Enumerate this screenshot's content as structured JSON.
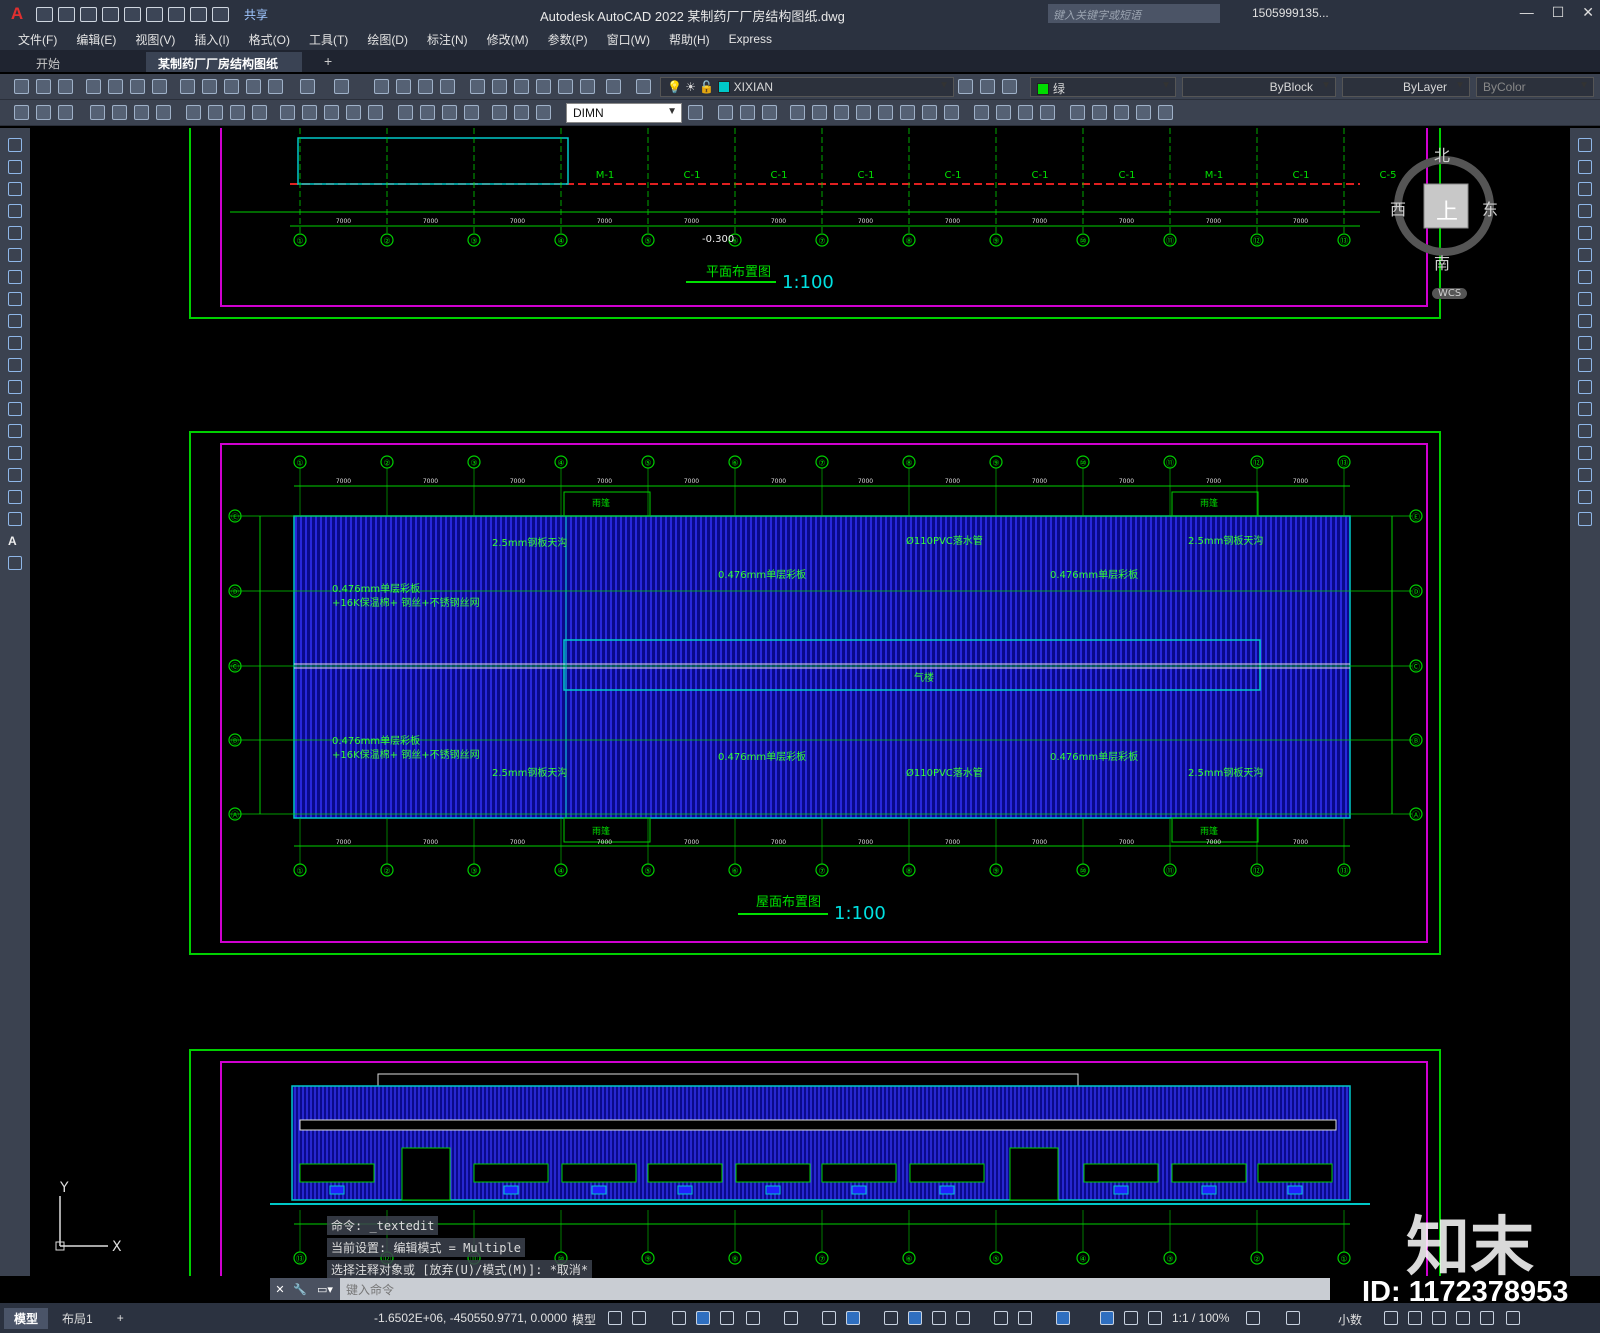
{
  "app": {
    "title": "Autodesk AutoCAD 2022    某制药厂厂房结构图纸.dwg",
    "logo": "A",
    "share": "共享",
    "search_placeholder": "键入关键字或短语",
    "user": "1505999135...",
    "min": "—",
    "max": "☐",
    "close": "✕"
  },
  "menu": [
    "文件(F)",
    "编辑(E)",
    "视图(V)",
    "插入(I)",
    "格式(O)",
    "工具(T)",
    "绘图(D)",
    "标注(N)",
    "修改(M)",
    "参数(P)",
    "窗口(W)",
    "帮助(H)",
    "Express"
  ],
  "tabs": {
    "start": "开始",
    "file": "某制药厂厂房结构图纸*",
    "close": "✕",
    "add": "+"
  },
  "toolbar": {
    "layer": "XIXIAN",
    "color": "绿",
    "linetype": "ByBlock",
    "lineweight": "ByLayer",
    "plotstyle": "ByColor",
    "dimstyle": "DIMN",
    "layer_color": "#00c8c8",
    "color_swatch": "#00dd00"
  },
  "viewcube": {
    "north": "北",
    "south": "南",
    "east": "东",
    "west": "西",
    "face": "上",
    "wcs": "WCS"
  },
  "drawing": {
    "plan_title": "平面布置图",
    "roof_title": "屋面布置图",
    "scale": "1:100",
    "axes": [
      "①",
      "②",
      "③",
      "④",
      "⑤",
      "⑥",
      "⑦",
      "⑧",
      "⑨",
      "⑩",
      "⑪",
      "⑫",
      "⑬"
    ],
    "rows": [
      "Ⓐ",
      "Ⓑ",
      "Ⓒ",
      "Ⓓ",
      "Ⓔ"
    ],
    "door_labels": [
      "M-1",
      "C-1",
      "C-1",
      "C-1",
      "C-1",
      "C-1",
      "C-1",
      "M-1",
      "C-1",
      "C-5"
    ],
    "dims": [
      "7000",
      "7000",
      "7000",
      "7000",
      "7000",
      "7000",
      "7000",
      "7000",
      "7000",
      "7000",
      "7000",
      "7000"
    ],
    "roof_notes": [
      "2.5mm钢板天沟",
      "0.476mm单层彩板",
      "Ø110PVC落水管",
      "0.476mm单层彩板",
      "2.5mm钢板天沟",
      "0.476mm单层彩板 +16K保温棉+ 钢丝+不锈钢丝网",
      "气楼",
      "0.476mm单层彩板 +16K保温棉+ 钢丝+不锈钢丝网",
      "2.5mm钢板天沟",
      "0.476mm单层彩板",
      "Ø110PVC落水管",
      "0.476mm单层彩板",
      "2.5mm钢板天沟"
    ],
    "canopy": "雨篷",
    "elev": "-0.300"
  },
  "command": {
    "history": [
      "命令: _textedit",
      "当前设置: 编辑模式 = Multiple",
      "选择注释对象或 [放弃(U)/模式(M)]: *取消*"
    ],
    "placeholder": "键入命令"
  },
  "status": {
    "model_tab": "模型",
    "layout_tab": "布局1",
    "add": "+",
    "coords": "-1.6502E+06, -450550.9771, 0.0000",
    "model": "模型",
    "scale": "1:1 / 100%",
    "units": "小数"
  },
  "watermark": {
    "brand": "知末",
    "id": "ID: 1172378953"
  }
}
